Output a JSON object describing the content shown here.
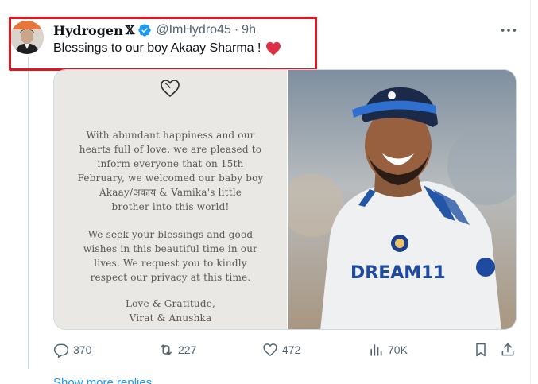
{
  "tweet": {
    "author_name": "Hydrogen",
    "author_name_badge": "𝕏",
    "handle": "@ImHydro45",
    "separator": "·",
    "time": "9h",
    "text": "Blessings to our boy Akaay Sharma !",
    "emoji": "red-heart"
  },
  "media": {
    "paragraph_1": "With abundant happiness and our\nhearts full of love, we are pleased to\ninform everyone that on 15th\nFebruary, we welcomed our baby boy\nAkaay/अकाय & Vamika's little\nbrother into this world!",
    "paragraph_2": "We seek your blessings and good\nwishes in this beautiful time in our\nlives. We request you to kindly\nrespect our privacy at this time.",
    "paragraph_3": "Love & Gratitude,\nVirat & Anushka",
    "photo_jersey_text": "DREAM11"
  },
  "actions": {
    "replies": "370",
    "reposts": "227",
    "likes": "472",
    "views": "70K"
  },
  "footer": {
    "show_more": "Show more replies"
  },
  "colors": {
    "accent": "#1d9bf0",
    "highlight": "#e0151f",
    "verified": "#1d9bf0",
    "heart": "#e0245e"
  }
}
